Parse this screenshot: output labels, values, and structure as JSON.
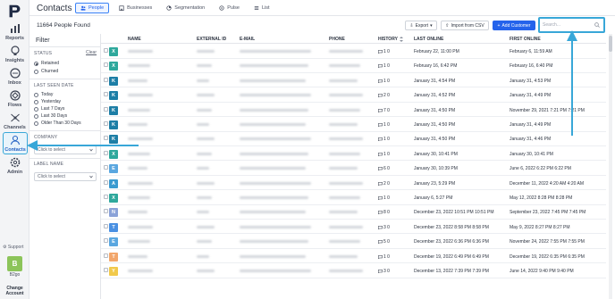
{
  "app": {
    "page_title": "Contacts",
    "people_found": "11664 People Found"
  },
  "rail": {
    "items": [
      {
        "label": "Reports",
        "icon": "reports-icon"
      },
      {
        "label": "Insights",
        "icon": "insights-icon"
      },
      {
        "label": "Inbox",
        "icon": "inbox-icon"
      },
      {
        "label": "Flows",
        "icon": "flows-icon"
      },
      {
        "label": "Channels",
        "icon": "channels-icon"
      },
      {
        "label": "Contacts",
        "icon": "contacts-icon"
      },
      {
        "label": "Admin",
        "icon": "admin-icon"
      }
    ],
    "support": "Support",
    "avatar_letter": "B",
    "user_name": "B2go",
    "change_account": "Change Account"
  },
  "tabs": [
    {
      "label": "People",
      "icon": "people-icon",
      "active": true
    },
    {
      "label": "Businesses",
      "icon": "business-icon",
      "active": false
    },
    {
      "label": "Segmentation",
      "icon": "segmentation-icon",
      "active": false
    },
    {
      "label": "Pulse",
      "icon": "pulse-icon",
      "active": false
    },
    {
      "label": "List",
      "icon": "list-icon",
      "active": false
    }
  ],
  "toolbar": {
    "export": "Export",
    "import": "Import from CSV",
    "add_customer": "Add Customer",
    "search_placeholder": "Search..."
  },
  "filter": {
    "title": "Filter",
    "status_label": "STATUS",
    "clear": "Clear",
    "status_options": [
      "Retained",
      "Churned"
    ],
    "status_selected": "Retained",
    "last_seen_label": "LAST SEEN DATE",
    "last_seen_options": [
      "Today",
      "Yesterday",
      "Last 7 Days",
      "Last 30 Days",
      "Older Than 30 Days"
    ],
    "company_label": "COMPANY",
    "company_placeholder": "Click to select",
    "label_name_label": "LABEL NAME",
    "label_name_placeholder": "Click to select"
  },
  "table": {
    "columns": [
      "NAME",
      "EXTERNAL ID",
      "E-MAIL",
      "PHONE",
      "HISTORY",
      "LAST ONLINE",
      "FIRST ONLINE"
    ],
    "rows": [
      {
        "letter": "X",
        "color": "#2ea89c",
        "hist": "1  0",
        "last": "February 22, 11:00 PM",
        "first": "February 6, 11:59 AM"
      },
      {
        "letter": "X",
        "color": "#2ea89c",
        "hist": "1  0",
        "last": "February 16, 6:42 PM",
        "first": "February 16, 6:40 PM"
      },
      {
        "letter": "K",
        "color": "#1d7ea6",
        "hist": "1  0",
        "last": "January 31, 4:54 PM",
        "first": "January 31, 4:53 PM"
      },
      {
        "letter": "K",
        "color": "#1d7ea6",
        "hist": "2  0",
        "last": "January 31, 4:52 PM",
        "first": "January 31, 4:49 PM"
      },
      {
        "letter": "K",
        "color": "#1d7ea6",
        "hist": "7  0",
        "last": "January 31, 4:50 PM",
        "first": "November 29, 2021 7:21 PM 7:21 PM"
      },
      {
        "letter": "K",
        "color": "#1d7ea6",
        "hist": "1  0",
        "last": "January 31, 4:50 PM",
        "first": "January 31, 4:49 PM"
      },
      {
        "letter": "K",
        "color": "#1d7ea6",
        "hist": "1  0",
        "last": "January 31, 4:50 PM",
        "first": "January 31, 4:46 PM"
      },
      {
        "letter": "X",
        "color": "#2ea89c",
        "hist": "1  0",
        "last": "January 30, 10:41 PM",
        "first": "January 30, 10:41 PM"
      },
      {
        "letter": "E",
        "color": "#5aa7e0",
        "hist": "6  0",
        "last": "January 30, 10:39 PM",
        "first": "June 6, 2022 6:22 PM 6:22 PM"
      },
      {
        "letter": "A",
        "color": "#3a9ad0",
        "hist": "2  0",
        "last": "January 23, 5:29 PM",
        "first": "December 11, 2022 4:20 AM 4:20 AM"
      },
      {
        "letter": "X",
        "color": "#2ea89c",
        "hist": "1  0",
        "last": "January 6, 5:27 PM",
        "first": "May 12, 2022 8:28 PM 8:28 PM"
      },
      {
        "letter": "N",
        "color": "#8aa2d8",
        "hist": "8  0",
        "last": "December 23, 2022 10:51 PM 10:51 PM",
        "first": "September 23, 2022 7:45 PM 7:45 PM"
      },
      {
        "letter": "T",
        "color": "#4a90e2",
        "hist": "3  0",
        "last": "December 23, 2022 8:58 PM 8:58 PM",
        "first": "May 9, 2022 8:27 PM 8:27 PM"
      },
      {
        "letter": "E",
        "color": "#5aa7e0",
        "hist": "5  0",
        "last": "December 23, 2022 6:36 PM 6:36 PM",
        "first": "November 24, 2022 7:55 PM 7:55 PM"
      },
      {
        "letter": "T",
        "color": "#f2a66b",
        "hist": "1  0",
        "last": "December 19, 2022 6:49 PM 6:49 PM",
        "first": "December 19, 2022 6:35 PM 6:35 PM"
      },
      {
        "letter": "Y",
        "color": "#f1c94b",
        "hist": "3  0",
        "last": "December 13, 2022 7:39 PM 7:39 PM",
        "first": "June 14, 2022 9:40 PM 9:40 PM"
      }
    ]
  }
}
